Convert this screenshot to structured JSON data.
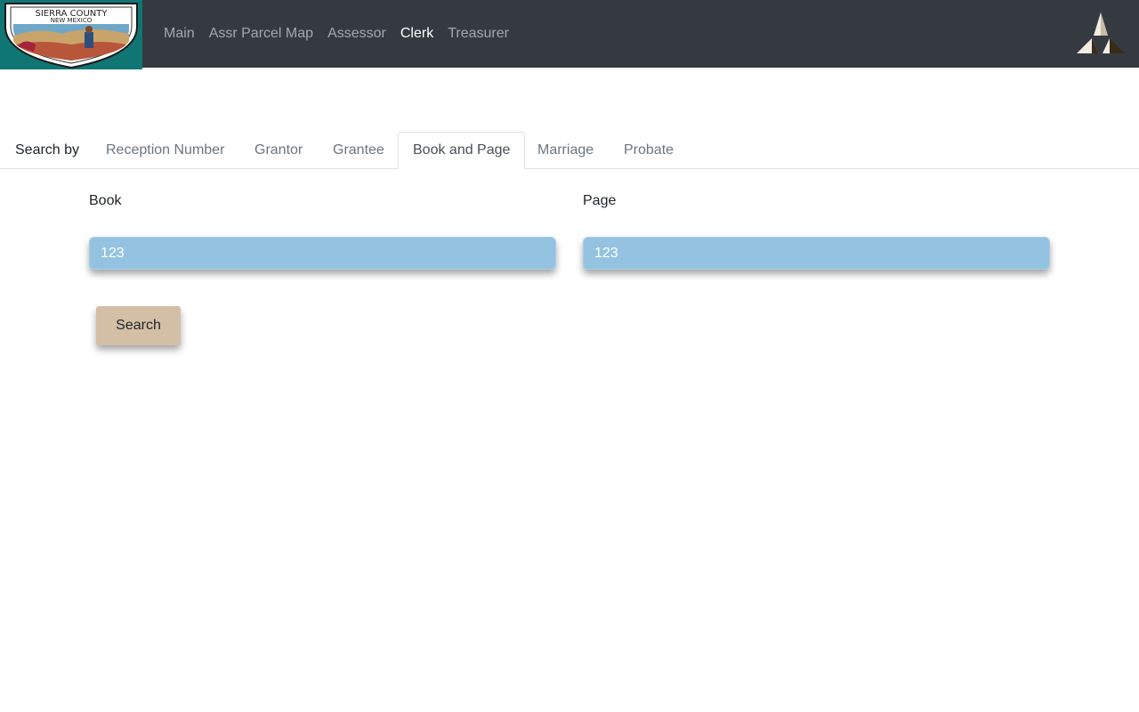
{
  "navbar": {
    "logo": {
      "name": "sierra-county-seal",
      "text_line1": "SIERRA COUNTY",
      "text_line2": "NEW MEXICO",
      "background": "#0f7673"
    },
    "links": [
      {
        "label": "Main",
        "active": false
      },
      {
        "label": "Assr Parcel Map",
        "active": false
      },
      {
        "label": "Assessor",
        "active": false
      },
      {
        "label": "Clerk",
        "active": true
      },
      {
        "label": "Treasurer",
        "active": false
      }
    ],
    "brand_icon": "triangle-mark-icon",
    "colors": {
      "background": "#343a40",
      "active_link": "#ffffff",
      "inactive_link": "#a4a6a9"
    }
  },
  "search_tabs": {
    "label": "Search by",
    "tabs": [
      {
        "label": "Reception Number",
        "active": false
      },
      {
        "label": "Grantor",
        "active": false
      },
      {
        "label": "Grantee",
        "active": false
      },
      {
        "label": "Book and Page",
        "active": true
      },
      {
        "label": "Marriage",
        "active": false
      },
      {
        "label": "Probate",
        "active": false
      }
    ]
  },
  "form": {
    "book": {
      "label": "Book",
      "value": "123"
    },
    "page": {
      "label": "Page",
      "value": "123"
    },
    "search_button": "Search",
    "colors": {
      "input_background": "#94c3e1",
      "button_background": "#d3bfa6"
    }
  }
}
